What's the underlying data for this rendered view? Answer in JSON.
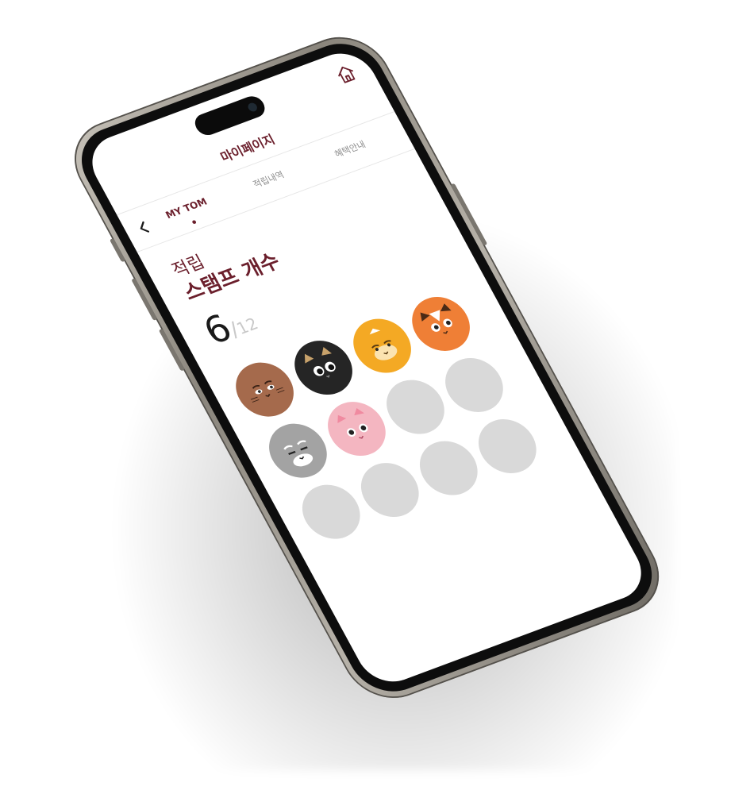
{
  "header": {
    "title": "마이페이지",
    "back_label": "<"
  },
  "tabs": [
    {
      "label": "MY TOM",
      "active": true
    },
    {
      "label": "적립내역",
      "active": false
    },
    {
      "label": "혜택안내",
      "active": false
    }
  ],
  "stamp_section": {
    "sub_label": "적립",
    "main_label": "스탬프 개수",
    "current": "6",
    "separator": "/",
    "total": "12"
  },
  "stamps": [
    {
      "filled": true,
      "icon": "cat-brown-icon",
      "color": "#a56a4c"
    },
    {
      "filled": true,
      "icon": "cat-black-icon",
      "color": "#252525"
    },
    {
      "filled": true,
      "icon": "cat-yellow-icon",
      "color": "#f4a924"
    },
    {
      "filled": true,
      "icon": "cat-orange-icon",
      "color": "#ef7f36"
    },
    {
      "filled": true,
      "icon": "cat-gray-icon",
      "color": "#a3a3a3"
    },
    {
      "filled": true,
      "icon": "cat-pink-icon",
      "color": "#f4b6c1"
    },
    {
      "filled": false
    },
    {
      "filled": false
    },
    {
      "filled": false
    },
    {
      "filled": false
    },
    {
      "filled": false
    },
    {
      "filled": false
    }
  ],
  "colors": {
    "accent": "#6b1f2c",
    "empty_stamp": "#d9d9d9",
    "frame": "#8a857c"
  },
  "icons": {
    "home": "home-icon",
    "back": "chevron-left-icon"
  }
}
